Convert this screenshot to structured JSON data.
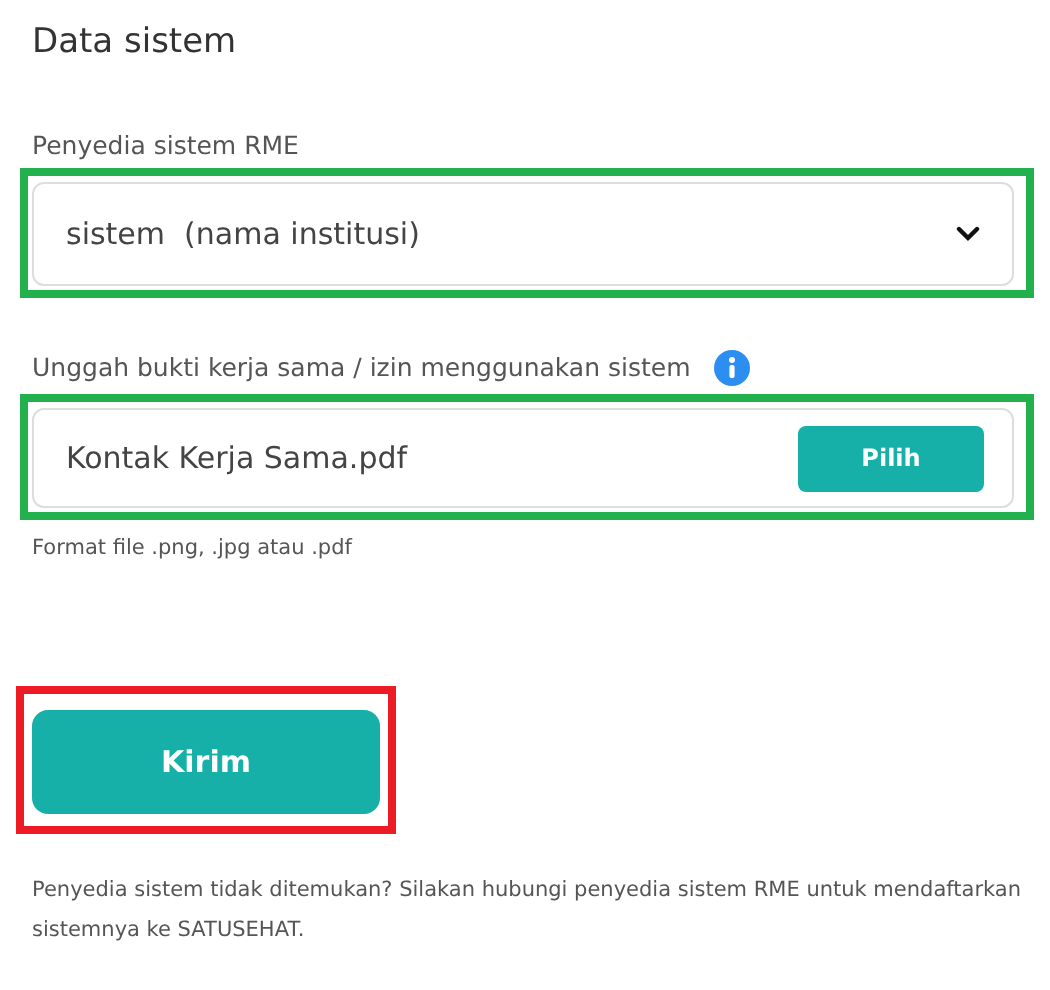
{
  "title": "Data sistem",
  "provider_field": {
    "label": "Penyedia sistem RME",
    "value": "sistem  (nama institusi)",
    "highlight": {
      "color": "#22b14c"
    }
  },
  "upload_field": {
    "label": "Unggah bukti kerja sama / izin menggunakan sistem",
    "value": "Kontak Kerja Sama.pdf",
    "button": "Pilih",
    "hint": "Format file .png, .jpg atau .pdf",
    "highlight": {
      "color": "#22b14c"
    }
  },
  "submit_button": {
    "label": "Kirim",
    "highlight": {
      "color": "#ed1c24"
    }
  },
  "footer_note": "Penyedia sistem tidak ditemukan? Silakan hubungi penyedia sistem RME untuk mendaftarkan sistemnya ke SATUSEHAT."
}
